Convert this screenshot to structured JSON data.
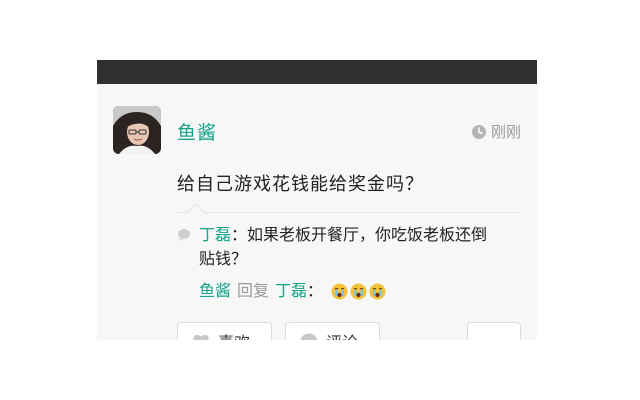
{
  "post": {
    "author": "鱼酱",
    "time": "刚刚",
    "text": "给自己游戏花钱能给奖金吗？"
  },
  "comments": [
    {
      "author": "丁磊",
      "separator": "：",
      "line1": "如果老板开餐厅，你吃饭老板还倒",
      "line2": "贴钱？"
    }
  ],
  "reply": {
    "from": "鱼酱",
    "verb": "回复",
    "to": "丁磊",
    "separator": "：",
    "emojis": [
      "crying-face-icon",
      "crying-face-icon",
      "crying-face-icon"
    ]
  },
  "actions": {
    "like_label": "喜欢",
    "comment_label": "评论",
    "more_icon": "more-dots-icon"
  },
  "colors": {
    "accent": "#1aa28a",
    "topbar": "#2f2f2f",
    "muted": "#9a9a9a",
    "background": "#f7f7f7"
  }
}
